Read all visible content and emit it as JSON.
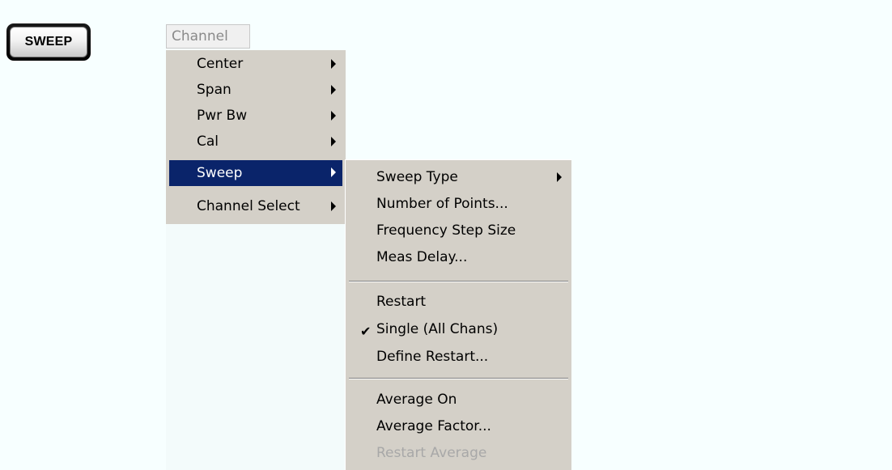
{
  "hardkey": {
    "label": "SWEEP"
  },
  "menubar": {
    "label": "Channel"
  },
  "channel_menu": {
    "items": [
      {
        "label": "Center",
        "submenu": true
      },
      {
        "label": "Span",
        "submenu": true
      },
      {
        "label": "Pwr Bw",
        "submenu": true
      },
      {
        "label": "Cal",
        "submenu": true
      },
      {
        "label": "Sweep",
        "submenu": true,
        "selected": true
      },
      {
        "label": "Channel Select",
        "submenu": true
      }
    ]
  },
  "sweep_menu": {
    "items": [
      {
        "label": "Sweep Type",
        "submenu": true
      },
      {
        "label": "Number of Points..."
      },
      {
        "label": "Frequency Step Size"
      },
      {
        "label": "Meas Delay..."
      },
      {
        "label": "Restart"
      },
      {
        "label": "Single (All Chans)",
        "checked": true
      },
      {
        "label": "Define Restart..."
      },
      {
        "label": "Average On"
      },
      {
        "label": "Average Factor..."
      },
      {
        "label": "Restart Average",
        "disabled": true
      }
    ],
    "check_glyph": "✔"
  },
  "colors": {
    "menu_bg": "#d4d0c8",
    "highlight": "#0a246a",
    "disabled_text": "#a8a8a8"
  }
}
